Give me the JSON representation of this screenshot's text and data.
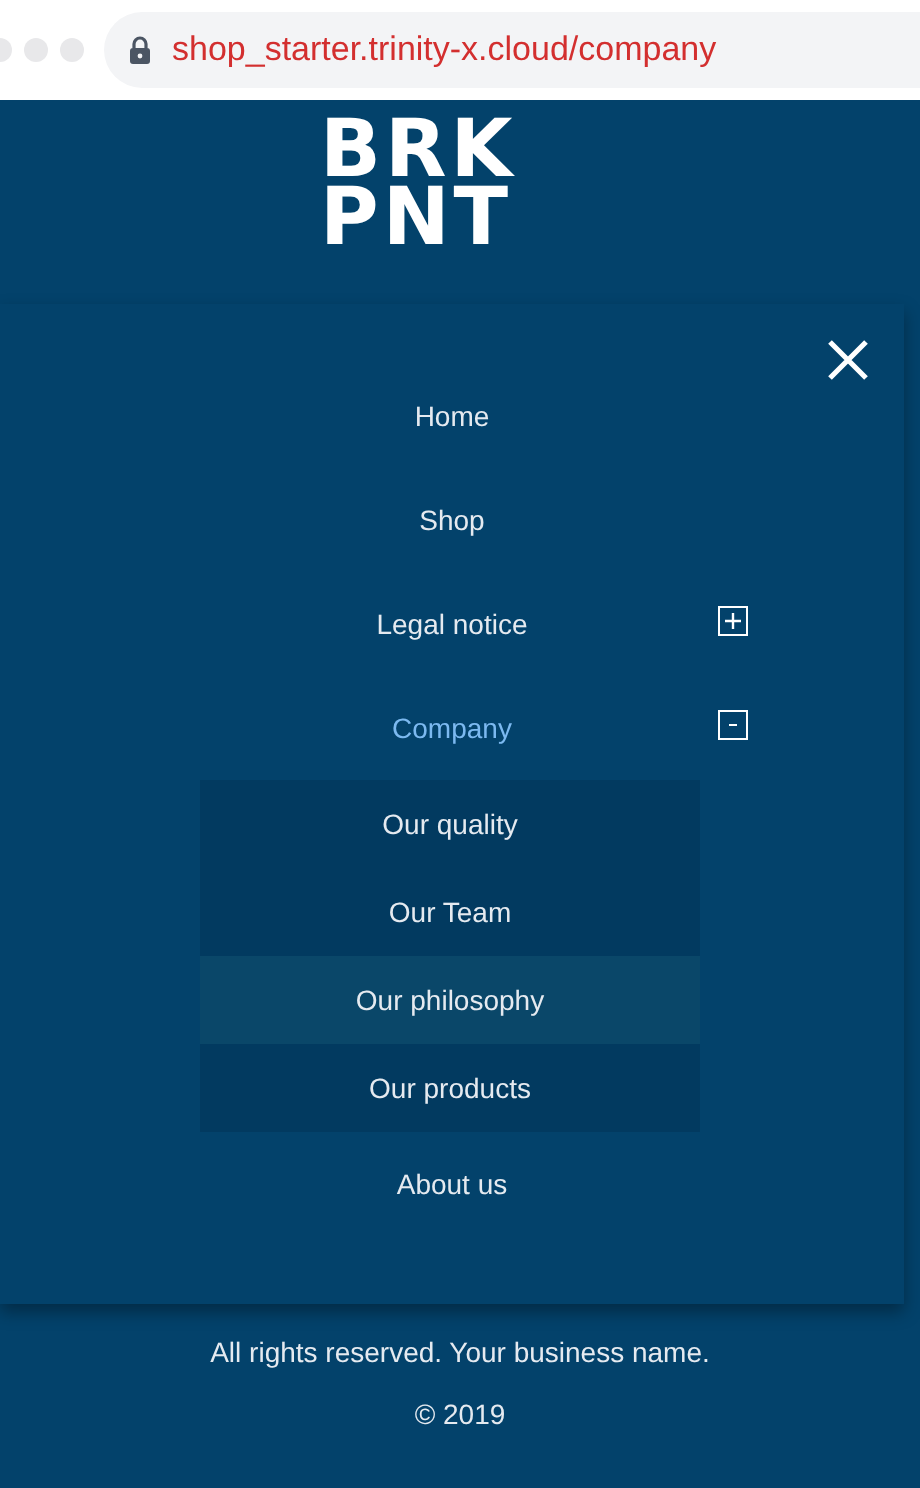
{
  "browser": {
    "url": "shop_starter.trinity-x.cloud/company"
  },
  "logo": {
    "lines": [
      "BRK",
      "PNT"
    ]
  },
  "menu": {
    "items": [
      {
        "label": "Home",
        "kind": "link",
        "selected": false
      },
      {
        "label": "Shop",
        "kind": "link",
        "selected": false
      },
      {
        "label": "Legal notice",
        "kind": "expandable",
        "selected": false,
        "expanded": false
      },
      {
        "label": "Company",
        "kind": "expandable",
        "selected": true,
        "expanded": true,
        "children": [
          {
            "label": "Our quality",
            "selected": false
          },
          {
            "label": "Our Team",
            "selected": false
          },
          {
            "label": "Our philosophy",
            "selected": true
          },
          {
            "label": "Our products",
            "selected": false
          }
        ]
      },
      {
        "label": "About us",
        "kind": "link",
        "selected": false
      }
    ]
  },
  "footer": {
    "lines": [
      "All rights reserved. Your business name.",
      "© 2019"
    ]
  }
}
